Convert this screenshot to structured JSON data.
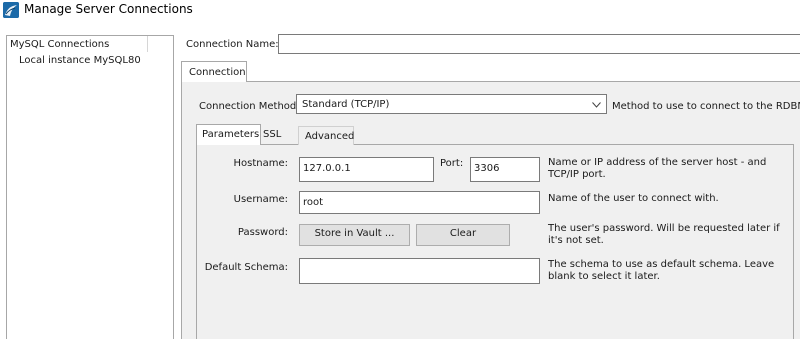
{
  "window": {
    "title": "Manage Server Connections",
    "icon": "mysql-workbench-icon"
  },
  "sidebar": {
    "root_label": "MySQL Connections",
    "items": [
      {
        "label": "Local instance MySQL80"
      }
    ]
  },
  "connection_name": {
    "label": "Connection Name:",
    "value": ""
  },
  "outer_tabs": [
    {
      "label": "Connection",
      "active": true
    }
  ],
  "connection_method": {
    "label": "Connection Method:",
    "selected": "Standard (TCP/IP)",
    "help": "Method to use to connect to the RDBMS"
  },
  "inner_tabs": [
    {
      "label": "Parameters",
      "active": true
    },
    {
      "label": "SSL",
      "active": false
    },
    {
      "label": "Advanced",
      "active": false
    }
  ],
  "parameters": {
    "hostname": {
      "label": "Hostname:",
      "value": "127.0.0.1",
      "help": "Name or IP address of the server host - and TCP/IP port."
    },
    "port": {
      "label": "Port:",
      "value": "3306"
    },
    "username": {
      "label": "Username:",
      "value": "root",
      "help": "Name of the user to connect with."
    },
    "password": {
      "label": "Password:",
      "store_button": "Store in Vault ...",
      "clear_button": "Clear",
      "help": "The user's password. Will be requested later if it's not set."
    },
    "default_schema": {
      "label": "Default Schema:",
      "value": "",
      "help": "The schema to use as default schema. Leave blank to select it later."
    }
  },
  "colors": {
    "panel_bg": "#f0f0f0",
    "border": "#a8a8a8",
    "app_icon": "#1c6aa8"
  }
}
